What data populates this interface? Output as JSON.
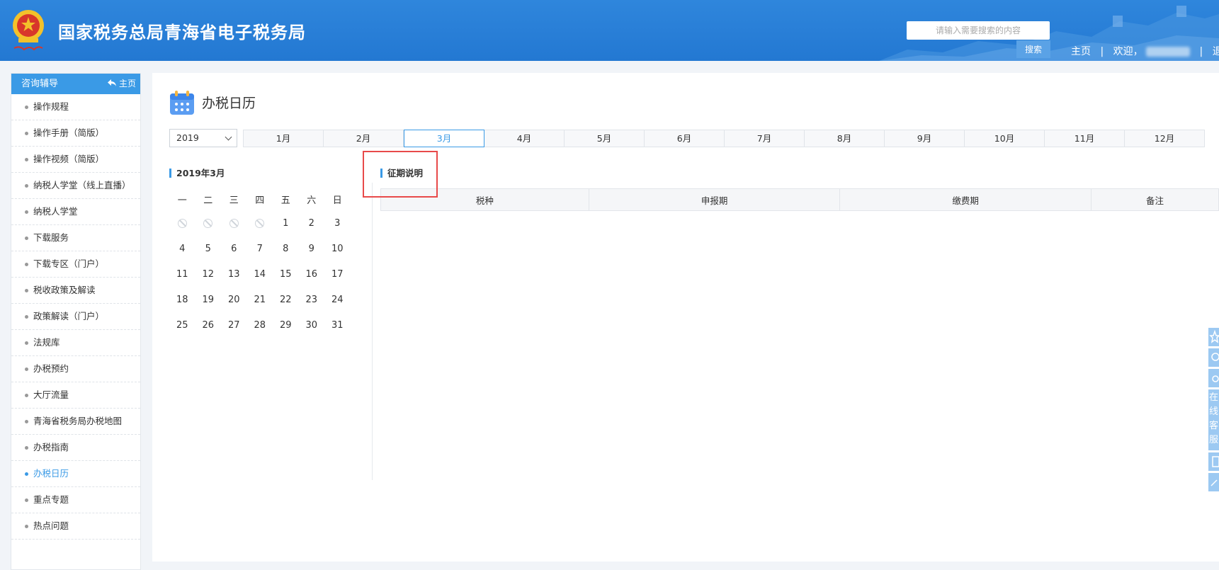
{
  "header": {
    "site_title": "国家税务总局青海省电子税务局",
    "search_placeholder": "请输入需要搜索的内容",
    "search_button": "搜索",
    "nav_home": "主页",
    "welcome": "欢迎，",
    "logout": "退出",
    "separator": "|"
  },
  "sidebar": {
    "title": "咨询辅导",
    "home_link": "主页",
    "items": [
      {
        "label": "操作规程"
      },
      {
        "label": "操作手册（简版）"
      },
      {
        "label": "操作视频（简版）"
      },
      {
        "label": "纳税人学堂（线上直播）"
      },
      {
        "label": "纳税人学堂"
      },
      {
        "label": "下载服务"
      },
      {
        "label": "下载专区（门户）"
      },
      {
        "label": "税收政策及解读"
      },
      {
        "label": "政策解读（门户）"
      },
      {
        "label": "法规库"
      },
      {
        "label": "办税预约"
      },
      {
        "label": "大厅流量"
      },
      {
        "label": "青海省税务局办税地图"
      },
      {
        "label": "办税指南"
      },
      {
        "label": "办税日历",
        "active": true
      },
      {
        "label": "重点专题"
      },
      {
        "label": "热点问题"
      }
    ]
  },
  "main": {
    "page_title": "办税日历",
    "year": "2019",
    "months": [
      "1月",
      "2月",
      "3月",
      "4月",
      "5月",
      "6月",
      "7月",
      "8月",
      "9月",
      "10月",
      "11月",
      "12月"
    ],
    "active_month": "3月",
    "calendar_title": "2019年3月",
    "weekdays": [
      "一",
      "二",
      "三",
      "四",
      "五",
      "六",
      "日"
    ],
    "weeks": [
      [
        "",
        "",
        "",
        "",
        "1",
        "2",
        "3"
      ],
      [
        "4",
        "5",
        "6",
        "7",
        "8",
        "9",
        "10"
      ],
      [
        "11",
        "12",
        "13",
        "14",
        "15",
        "16",
        "17"
      ],
      [
        "18",
        "19",
        "20",
        "21",
        "22",
        "23",
        "24"
      ],
      [
        "25",
        "26",
        "27",
        "28",
        "29",
        "30",
        "31"
      ]
    ],
    "period_title": "征期说明",
    "table_headers": [
      "税种",
      "申报期",
      "缴费期",
      "备注"
    ]
  },
  "float_bar": {
    "labels": [
      "在",
      "线",
      "客",
      "服"
    ]
  },
  "colors": {
    "header_blue": "#2378d2",
    "accent": "#3a9ae6",
    "highlight_red": "#e84a4a"
  }
}
